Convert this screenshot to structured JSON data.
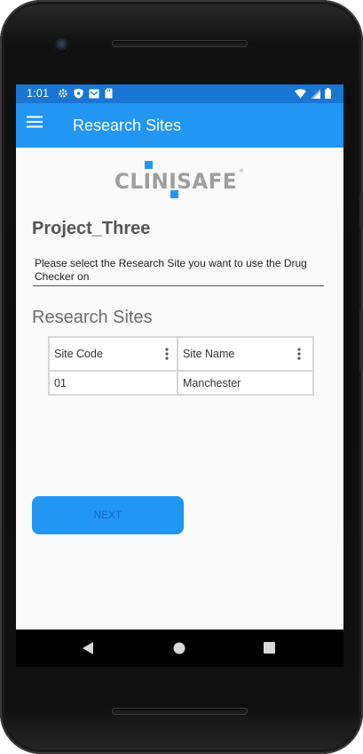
{
  "status_bar": {
    "time": "1:01",
    "left_icons": [
      "gear-icon",
      "shield-icon",
      "mail-icon",
      "sd-card-icon"
    ],
    "right_icons": [
      "wifi-icon",
      "signal-icon",
      "battery-icon"
    ]
  },
  "app_bar": {
    "menu_icon": "hamburger-menu-icon",
    "title": "Research Sites"
  },
  "logo": {
    "text": "CLINISAFE",
    "mark": "®",
    "accent_color": "#2196f3",
    "text_color": "#9e9e9e"
  },
  "project": {
    "name": "Project_Three"
  },
  "instruction": {
    "text": "Please select the Research Site you want to use the Drug Checker on"
  },
  "sites_section": {
    "title": "Research Sites",
    "columns": [
      {
        "label": "Site Code",
        "menu_icon": "more-vert-icon"
      },
      {
        "label": "Site Name",
        "menu_icon": "more-vert-icon"
      }
    ],
    "rows": [
      {
        "code": "01",
        "name": "Manchester"
      }
    ]
  },
  "next_button": {
    "label": "NEXT",
    "enabled": false
  },
  "nav_bar": {
    "icons": [
      "back-icon",
      "home-icon",
      "recents-icon"
    ]
  },
  "colors": {
    "status_bar": "#1976d2",
    "app_bar": "#2196f3",
    "button": "#2196f3",
    "button_text": "#1565c0",
    "background": "#fafafa"
  }
}
